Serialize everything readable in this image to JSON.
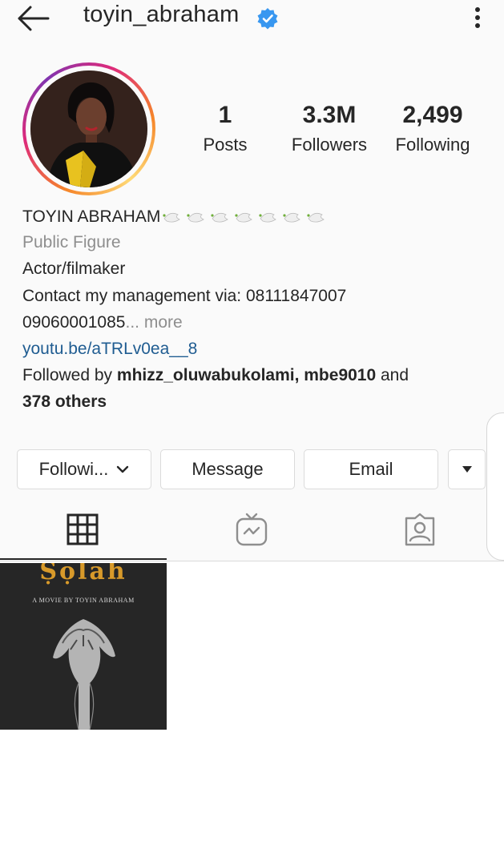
{
  "header": {
    "username": "toyin_abraham",
    "verified": true,
    "back_icon": "arrow-left-icon",
    "menu_icon": "kebab-menu-icon"
  },
  "stats": {
    "posts": {
      "value": "1",
      "label": "Posts"
    },
    "followers": {
      "value": "3.3M",
      "label": "Followers"
    },
    "following": {
      "value": "2,499",
      "label": "Following"
    }
  },
  "bio": {
    "name": "TOYIN ABRAHAM",
    "category": "Public Figure",
    "role": "Actor/filmaker",
    "contact": "Contact my management via: 08111847007",
    "phone2": "09060001085",
    "more": "... more",
    "link": "youtu.be/aTRLv0ea__8",
    "followed_by_prefix": "Followed by ",
    "followed_by_users": "mhizz_oluwabukolami, mbe9010",
    "followed_by_and": " and",
    "followed_by_others": "378 others"
  },
  "buttons": {
    "following": "Followi...",
    "message": "Message",
    "email": "Email"
  },
  "tabs": [
    "grid-icon",
    "igtv-icon",
    "tagged-icon"
  ],
  "post": {
    "title": "Ṣọlah",
    "credit": "A MOVIE BY TOYIN ABRAHAM"
  },
  "colors": {
    "verified_blue": "#3897f0",
    "link_blue": "#1f5c91",
    "secondary_text": "#8e8e8e",
    "title_gold": "#d89a2a"
  }
}
